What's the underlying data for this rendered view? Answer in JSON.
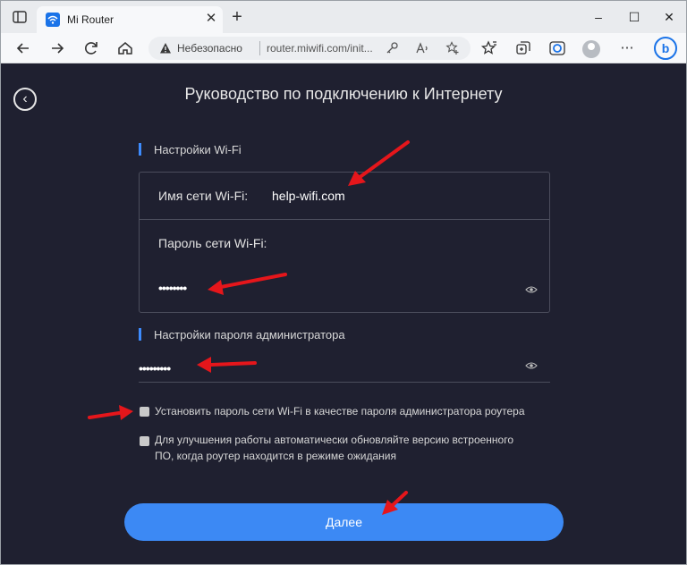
{
  "browser": {
    "tab_title": "Mi Router",
    "tab_close": "✕",
    "new_tab": "+",
    "window_controls": {
      "minimize": "–",
      "maximize": "☐",
      "close": "✕"
    },
    "security_label": "Небезопасно",
    "url": "router.miwifi.com/init...",
    "icons": [
      "sidebar-icon",
      "wifi-favicon",
      "back-icon",
      "forward-icon",
      "refresh-icon",
      "home-icon",
      "warning-icon",
      "key-icon",
      "read-aloud-icon",
      "add-favorite-icon",
      "favorites-icon",
      "collections-icon",
      "edge-icon",
      "profile-icon",
      "bing-icon"
    ],
    "bing_label": "b"
  },
  "page": {
    "title": "Руководство по подключению к Интернету",
    "back_symbol": "‹",
    "wifi_section": {
      "heading": "Настройки Wi-Fi",
      "ssid_label": "Имя сети Wi-Fi:",
      "ssid_value": "help-wifi.com",
      "password_label": "Пароль сети Wi-Fi:",
      "password_mask": "••••••••"
    },
    "admin_section": {
      "heading": "Настройки пароля администратора",
      "password_mask": "•••••••••"
    },
    "checkboxes": [
      {
        "label": "Установить пароль сети Wi-Fi в качестве пароля администратора роутера",
        "checked": true
      },
      {
        "label_line1": "Для улучшения работы автоматически обновляйте версию встроенного",
        "label_line2": "ПО, когда роутер находится в режиме ожидания",
        "checked": true
      }
    ],
    "next_button": "Далее"
  },
  "colors": {
    "page_bg": "#1f2030",
    "accent": "#3c89f4",
    "section_marker": "#3d8bfd",
    "annotation_arrow": "#e5161b"
  }
}
